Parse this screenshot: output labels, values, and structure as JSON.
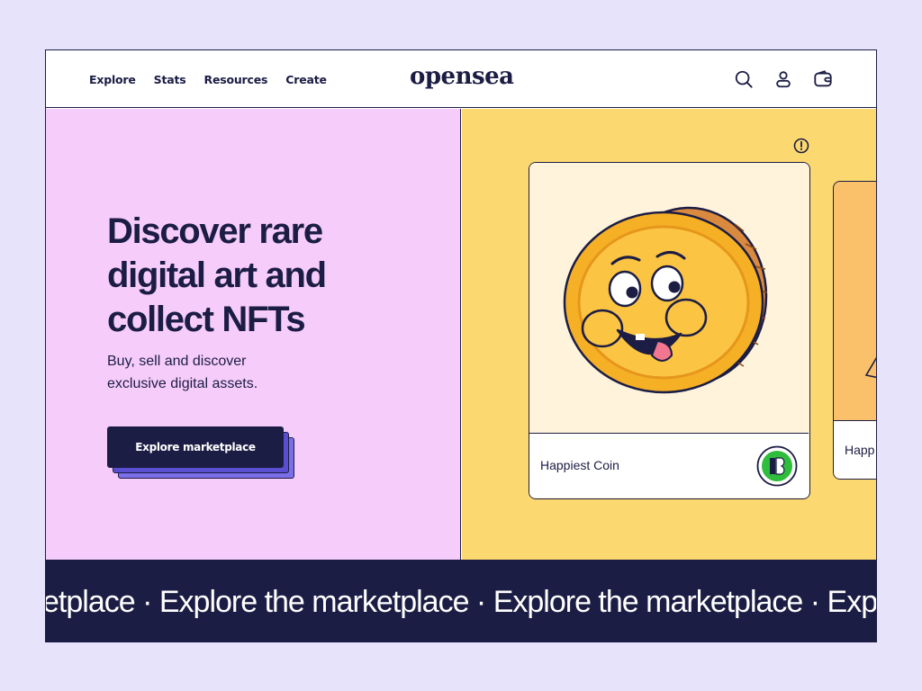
{
  "header": {
    "nav": [
      "Explore",
      "Stats",
      "Resources",
      "Create"
    ],
    "logo": "opensea",
    "icons": [
      "search-icon",
      "user-icon",
      "wallet-icon"
    ]
  },
  "hero": {
    "headline_lines": [
      "Discover rare",
      "digital art and",
      "collect NFTs"
    ],
    "subline_lines": [
      "Buy, sell and discover",
      "exclusive digital assets."
    ],
    "cta_label": "Explore marketplace"
  },
  "cards": [
    {
      "title": "Happiest Coin",
      "badge_icon": "collection-badge-icon"
    },
    {
      "title": "Happ"
    }
  ],
  "marquee": {
    "text": "etplace · Explore the marketplace · Explore the marketplace · Explo"
  },
  "colors": {
    "navy": "#1c1d44",
    "background": "#e6e3fb",
    "hero_pink": "#f6ccfa",
    "hero_yellow": "#fcd970",
    "accent_purple": "#7b6ee9",
    "badge_green": "#2ebd3c"
  }
}
